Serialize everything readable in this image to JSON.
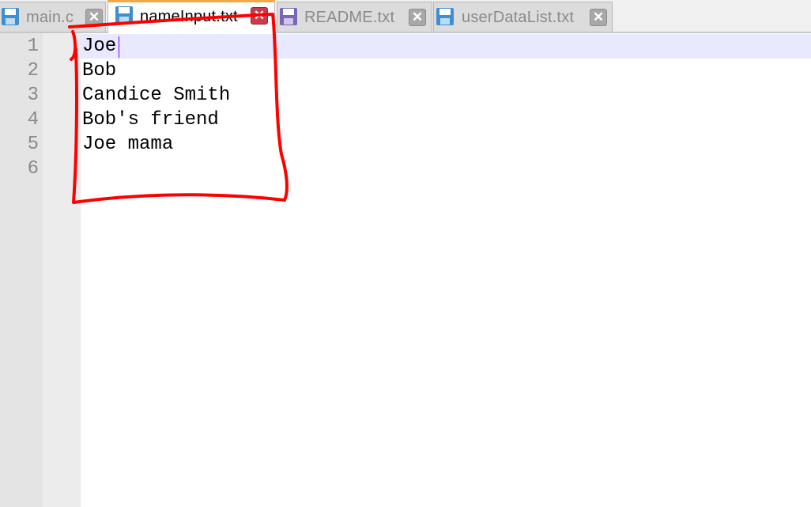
{
  "tabs": [
    {
      "label": "main.c",
      "close": "✕",
      "icon": "floppy-disk-icon",
      "state": "saved"
    },
    {
      "label": "nameInput.txt",
      "close": "✕",
      "icon": "floppy-disk-icon",
      "state": "active"
    },
    {
      "label": "README.txt",
      "close": "✕",
      "icon": "floppy-disk-icon",
      "state": "saved"
    },
    {
      "label": "userDataList.txt",
      "close": "✕",
      "icon": "floppy-disk-icon",
      "state": "saved"
    }
  ],
  "editor": {
    "line_numbers": [
      "1",
      "2",
      "3",
      "4",
      "5",
      "6"
    ],
    "lines": [
      "Joe",
      "Bob",
      "Candice Smith",
      "Bob's friend",
      "Joe mama",
      ""
    ]
  },
  "colors": {
    "active_tab_accent": "#f5a742",
    "active_close": "#cc3b4a",
    "current_line": "#e8e8ff",
    "annotation": "#ff0000"
  }
}
